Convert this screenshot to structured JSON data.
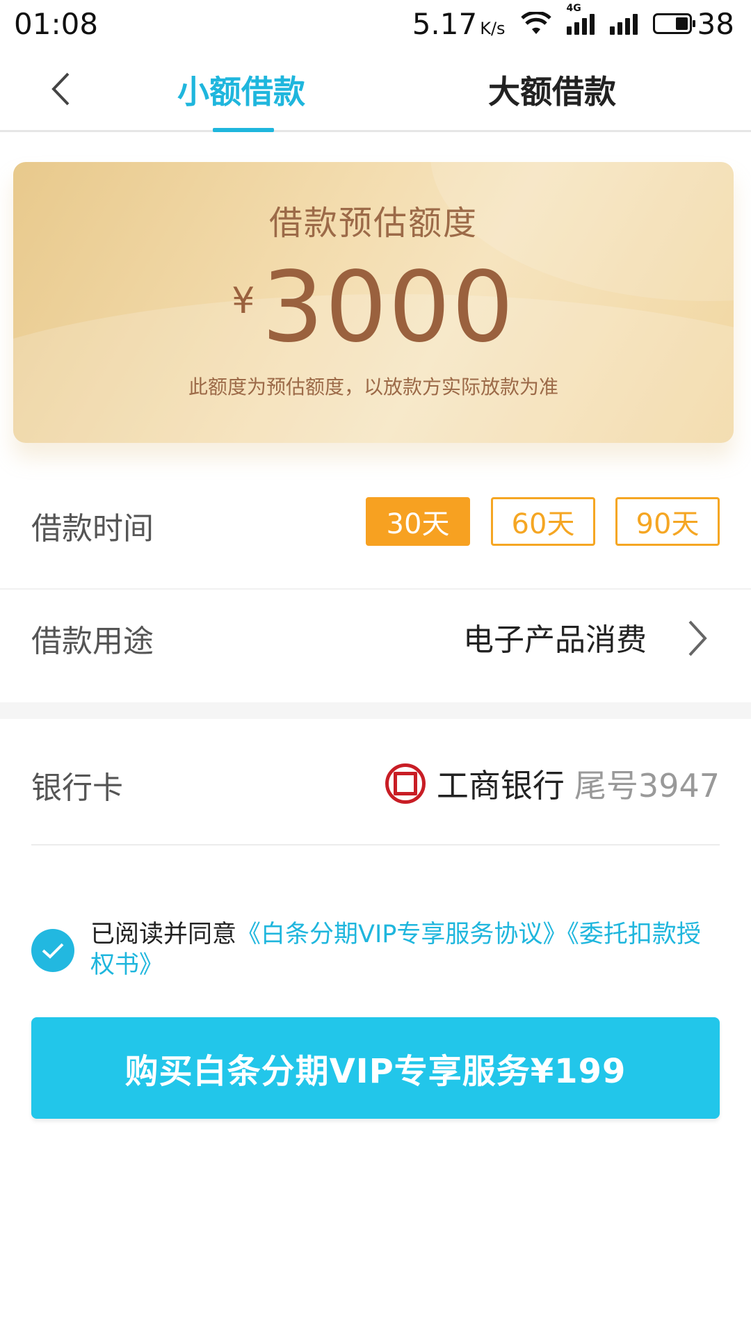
{
  "status_bar": {
    "time": "01:08",
    "net_speed": "5.17",
    "net_speed_unit": "K/s",
    "network_type": "4G",
    "battery": "38",
    "battery_level": 0.38
  },
  "header": {
    "back_icon": "chevron-left-icon",
    "tabs": [
      {
        "label": "小额借款",
        "active": true
      },
      {
        "label": "大额借款",
        "active": false
      }
    ]
  },
  "credit": {
    "title": "借款预估额度",
    "currency": "¥",
    "amount": "3000",
    "note": "此额度为预估额度，以放款方实际放款为准"
  },
  "loan_term": {
    "label": "借款时间",
    "options": [
      "30天",
      "60天",
      "90天"
    ],
    "selected": "30天"
  },
  "loan_purpose": {
    "label": "借款用途",
    "value": "电子产品消费"
  },
  "bank_card": {
    "label": "银行卡",
    "bank_name": "工商银行",
    "tail": "尾号3947",
    "brand_color": "#c81d25"
  },
  "agreement": {
    "checked": true,
    "prefix": "已阅读并同意",
    "link1": "《白条分期VIP专享服务协议》",
    "link2": "《委托扣款授权书》"
  },
  "buy_button": {
    "label": "购买白条分期VIP专享服务¥199"
  },
  "colors": {
    "accent": "#1fb6dd",
    "button": "#22c6ea",
    "term_selected": "#f7a121",
    "card_text": "#9a613e"
  }
}
